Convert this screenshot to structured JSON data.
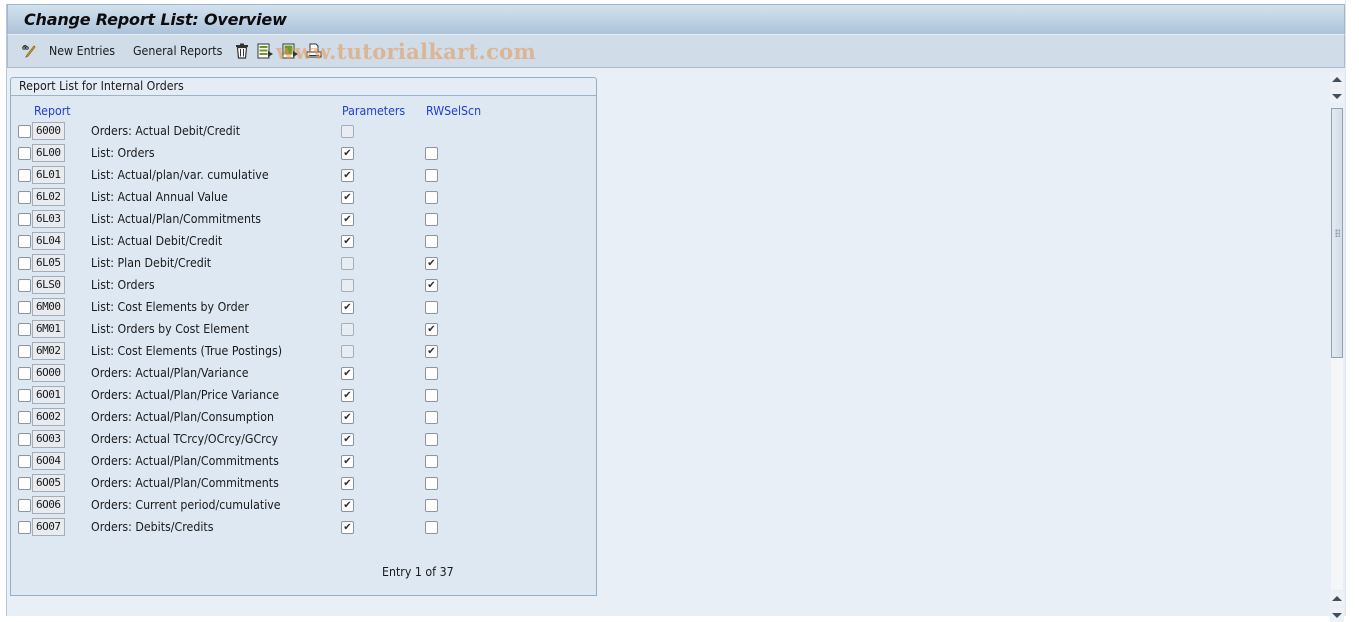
{
  "window": {
    "title": "Change Report List: Overview"
  },
  "toolbar": {
    "items": [
      {
        "name": "change-display-icon",
        "label": ""
      },
      {
        "name": "new-entries-button",
        "label": "New Entries"
      },
      {
        "name": "general-reports-button",
        "label": "General Reports"
      },
      {
        "name": "delete-icon",
        "label": ""
      },
      {
        "name": "select-all-icon",
        "label": ""
      },
      {
        "name": "select-block-icon",
        "label": ""
      },
      {
        "name": "print-icon",
        "label": ""
      }
    ],
    "watermark": "www.tutorialkart.com"
  },
  "group": {
    "title": "Report List for Internal Orders",
    "columns": {
      "report": "Report",
      "parameters": "Parameters",
      "rwselscn": "RWSelScn"
    },
    "rows": [
      {
        "code": "6000",
        "desc": "Orders: Actual Debit/Credit",
        "parameters": false,
        "parameters_enabled": false,
        "rwselscn": null
      },
      {
        "code": "6L00",
        "desc": "List: Orders",
        "parameters": true,
        "parameters_enabled": true,
        "rwselscn": false
      },
      {
        "code": "6L01",
        "desc": "List: Actual/plan/var. cumulative",
        "parameters": true,
        "parameters_enabled": true,
        "rwselscn": false
      },
      {
        "code": "6L02",
        "desc": "List: Actual Annual Value",
        "parameters": true,
        "parameters_enabled": true,
        "rwselscn": false
      },
      {
        "code": "6L03",
        "desc": "List: Actual/Plan/Commitments",
        "parameters": true,
        "parameters_enabled": true,
        "rwselscn": false
      },
      {
        "code": "6L04",
        "desc": "List: Actual Debit/Credit",
        "parameters": true,
        "parameters_enabled": true,
        "rwselscn": false
      },
      {
        "code": "6L05",
        "desc": "List: Plan Debit/Credit",
        "parameters": false,
        "parameters_enabled": false,
        "rwselscn": true
      },
      {
        "code": "6LS0",
        "desc": "List: Orders",
        "parameters": false,
        "parameters_enabled": false,
        "rwselscn": true
      },
      {
        "code": "6M00",
        "desc": "List: Cost Elements by Order",
        "parameters": true,
        "parameters_enabled": true,
        "rwselscn": false
      },
      {
        "code": "6M01",
        "desc": "List: Orders by Cost Element",
        "parameters": false,
        "parameters_enabled": false,
        "rwselscn": true
      },
      {
        "code": "6M02",
        "desc": "List: Cost Elements (True Postings)",
        "parameters": false,
        "parameters_enabled": false,
        "rwselscn": true
      },
      {
        "code": "6O00",
        "desc": "Orders: Actual/Plan/Variance",
        "parameters": true,
        "parameters_enabled": true,
        "rwselscn": false
      },
      {
        "code": "6O01",
        "desc": "Orders: Actual/Plan/Price Variance",
        "parameters": true,
        "parameters_enabled": true,
        "rwselscn": false
      },
      {
        "code": "6O02",
        "desc": "Orders: Actual/Plan/Consumption",
        "parameters": true,
        "parameters_enabled": true,
        "rwselscn": false
      },
      {
        "code": "6O03",
        "desc": "Orders: Actual TCrcy/OCrcy/GCrcy",
        "parameters": true,
        "parameters_enabled": true,
        "rwselscn": false
      },
      {
        "code": "6O04",
        "desc": "Orders: Actual/Plan/Commitments",
        "parameters": true,
        "parameters_enabled": true,
        "rwselscn": false
      },
      {
        "code": "6O05",
        "desc": "Orders: Actual/Plan/Commitments",
        "parameters": true,
        "parameters_enabled": true,
        "rwselscn": false
      },
      {
        "code": "6O06",
        "desc": "Orders: Current period/cumulative",
        "parameters": true,
        "parameters_enabled": true,
        "rwselscn": false
      },
      {
        "code": "6O07",
        "desc": "Orders: Debits/Credits",
        "parameters": true,
        "parameters_enabled": true,
        "rwselscn": false
      }
    ],
    "entry_status": "Entry 1 of 37"
  },
  "colors": {
    "title_gradient_top": "#d3e2ee",
    "title_gradient_bottom": "#abc3da",
    "toolbar_bg": "#d0dce7",
    "content_bg": "#e9eff6",
    "group_bg": "#dde8f3",
    "column_header": "#1e3fd0"
  }
}
